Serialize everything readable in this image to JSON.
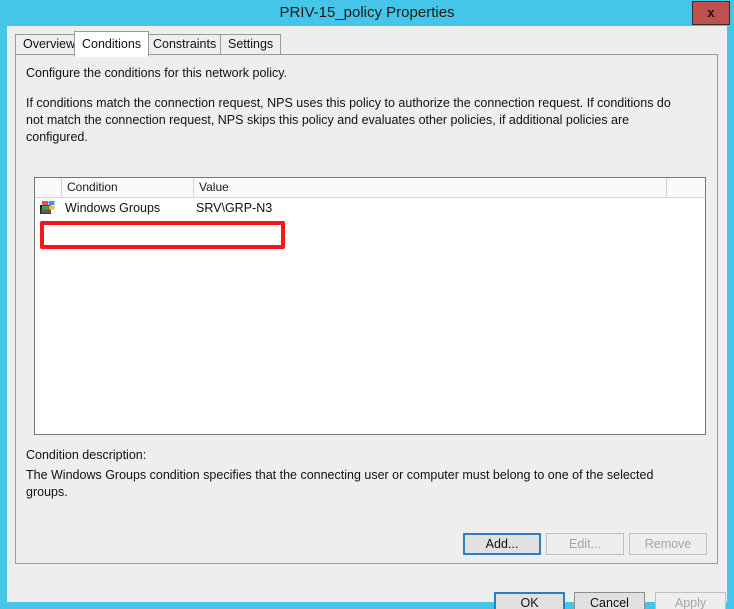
{
  "window": {
    "title": "PRIV-15_policy Properties",
    "close_label": "x",
    "titlebar_color": "#45c6e8",
    "close_button_color": "#c0504d"
  },
  "tabs": [
    {
      "label": "Overview",
      "selected": false
    },
    {
      "label": "Conditions",
      "selected": true
    },
    {
      "label": "Constraints",
      "selected": false
    },
    {
      "label": "Settings",
      "selected": false
    }
  ],
  "page": {
    "intro": "Configure the conditions for this network policy.",
    "explanation": "If conditions match the connection request, NPS uses this policy to authorize the connection request. If conditions do not match the connection request, NPS skips this policy and evaluates other policies, if additional policies are configured."
  },
  "conditions_list": {
    "columns": [
      "",
      "Condition",
      "Value",
      ""
    ],
    "rows": [
      {
        "icon": "windows-groups-icon",
        "condition": "Windows Groups",
        "value": "SRV\\GRP-N3"
      }
    ]
  },
  "annotation": {
    "color": "#fb1516",
    "targets": "conditions-row-windows-groups"
  },
  "description": {
    "label": "Condition description:",
    "text": "The Windows Groups condition specifies that the connecting user or computer must belong to one of the selected groups."
  },
  "list_buttons": [
    {
      "name": "add",
      "label": "Add...",
      "mnemonic": "d",
      "enabled": true,
      "focused": true
    },
    {
      "name": "edit",
      "label": "Edit...",
      "mnemonic": "E",
      "enabled": false,
      "focused": false
    },
    {
      "name": "remove",
      "label": "Remove",
      "mnemonic": "R",
      "enabled": false,
      "focused": false
    }
  ],
  "dialog_buttons": [
    {
      "name": "ok",
      "label": "OK",
      "enabled": true,
      "default": true
    },
    {
      "name": "cancel",
      "label": "Cancel",
      "enabled": true,
      "default": false
    },
    {
      "name": "apply",
      "label": "Apply",
      "mnemonic": "A",
      "enabled": false,
      "default": false
    }
  ]
}
